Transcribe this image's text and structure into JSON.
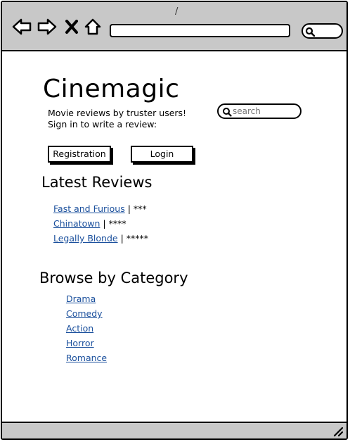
{
  "browser": {
    "tab_mark": "/",
    "address": "",
    "icons": [
      "back-arrow-icon",
      "forward-arrow-icon",
      "close-icon",
      "home-icon",
      "search-icon",
      "resize-grip-icon"
    ]
  },
  "site": {
    "title": "Cinemagic",
    "tagline_line1": "Movie reviews by truster users!",
    "tagline_line2": "Sign in to write a review:"
  },
  "search": {
    "placeholder": "search"
  },
  "buttons": {
    "registration": "Registration",
    "login": "Login"
  },
  "latest_reviews": {
    "heading": "Latest Reviews",
    "items": [
      {
        "title": "Fast and Furious",
        "rating": "| ***"
      },
      {
        "title": "Chinatown",
        "rating": "| ****"
      },
      {
        "title": "Legally Blonde",
        "rating": "| *****"
      }
    ]
  },
  "categories": {
    "heading": "Browse by Category",
    "items": [
      "Drama",
      "Comedy",
      "Action",
      "Horror",
      "Romance"
    ]
  },
  "colors": {
    "toolbar": "#c8c8c8",
    "link": "#1a4f9c",
    "border": "#000000"
  }
}
